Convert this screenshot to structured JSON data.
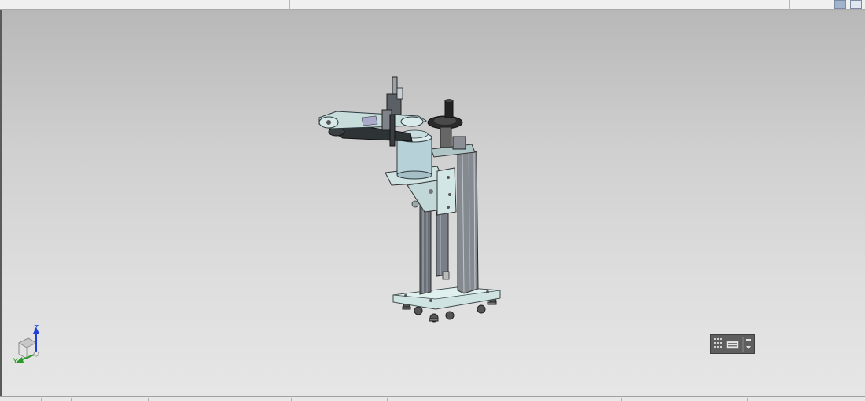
{
  "viewport": {
    "background_top": "#b8b8b8",
    "background_bottom": "#e6e6e6",
    "model": "robot-arm-assembly"
  },
  "triad": {
    "z_label": "Z",
    "y_label": "Y",
    "z_axis_color": "#1f3fd6",
    "y_axis_color": "#2a9a2a"
  },
  "toolbar": {
    "icons": [
      "view-settings-icon",
      "window-restore-icon"
    ]
  },
  "keyboard_widget": {
    "icons": [
      "grid-icon",
      "keyboard-icon",
      "arrow-icon"
    ]
  }
}
